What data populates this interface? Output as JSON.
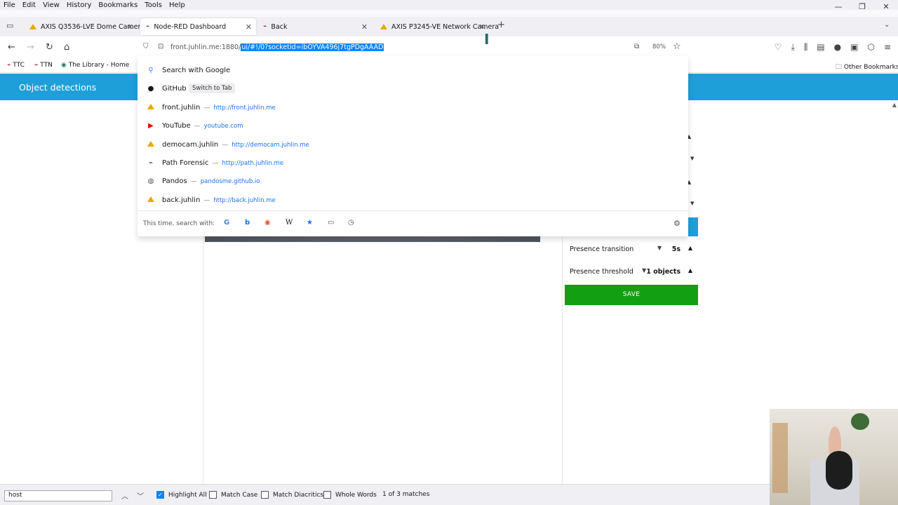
{
  "menu": [
    "File",
    "Edit",
    "View",
    "History",
    "Bookmarks",
    "Tools",
    "Help"
  ],
  "window_controls": [
    "—",
    "❐",
    "✕"
  ],
  "tabs": [
    {
      "label": "AXIS Q3536-LVE Dome Camera",
      "favicon": "axis-icon"
    },
    {
      "label": "Node-RED Dashboard",
      "favicon": "node-red-icon",
      "active": true
    },
    {
      "label": "Back",
      "favicon": "node-red-icon"
    },
    {
      "label": "AXIS P3245-VE Network Camera",
      "favicon": "axis-icon"
    }
  ],
  "new_tab": "+",
  "url": {
    "prefix": "front.juhlin.me:1880/",
    "selected": "ui/#!/0?socketid=ibOYVA496j7tgPDgAAAD",
    "zoom": "80%"
  },
  "bookmarks": [
    "TTC",
    "TTN",
    "The Library - Home",
    "Other Bookmarks"
  ],
  "dashboard": {
    "title": "Object detections",
    "settings": [
      {
        "label": "Presence transition",
        "value": "5s"
      },
      {
        "label": "Presence threshold",
        "value": "1 objects"
      }
    ],
    "save_label": "SAVE"
  },
  "dropdown": {
    "search_label": "Search with Google",
    "items": [
      {
        "title": "GitHub",
        "badge": "Switch to Tab",
        "icon": "github-icon"
      },
      {
        "title": "front.juhlin",
        "url": "http://front.juhlin.me",
        "icon": "axis-icon"
      },
      {
        "title": "YouTube",
        "url": "youtube.com",
        "icon": "youtube-icon"
      },
      {
        "title": "democam.juhlin",
        "url": "http://democam.juhlin.me",
        "icon": "axis-icon"
      },
      {
        "title": "Path Forensic",
        "url": "http://path.juhlin.me",
        "icon": "node-red-icon"
      },
      {
        "title": "Pandos",
        "url": "pandosme.github.io",
        "icon": "globe-icon"
      },
      {
        "title": "back.juhlin",
        "url": "http://back.juhlin.me",
        "icon": "axis-icon"
      }
    ],
    "search_with_label": "This time, search with:",
    "engines": [
      "google-icon",
      "bing-icon",
      "duckduckgo-icon",
      "wikipedia-icon",
      "bookmarks-icon",
      "tabs-icon",
      "history-icon"
    ]
  },
  "findbar": {
    "query": "host",
    "options": [
      {
        "label": "Highlight All",
        "checked": true
      },
      {
        "label": "Match Case",
        "checked": false
      },
      {
        "label": "Match Diacritics",
        "checked": false
      },
      {
        "label": "Whole Words",
        "checked": false
      }
    ],
    "status": "1 of 3 matches"
  },
  "colors": {
    "dashboard_header": "#1f9fd9",
    "save_button": "#12a012",
    "url_selection": "#0a84ff"
  }
}
